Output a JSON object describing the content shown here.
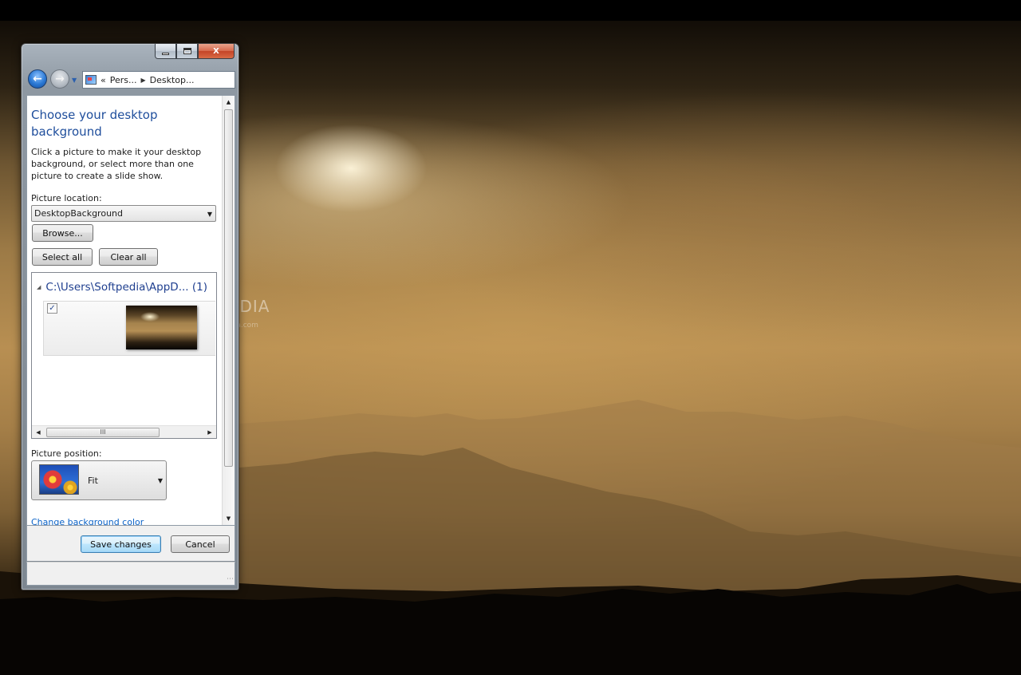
{
  "window": {
    "caption_buttons": {
      "minimize_icon": "minimize-icon",
      "maximize_icon": "maximize-icon",
      "close_label": "X"
    },
    "address_bar": {
      "prefix": "«",
      "crumb1": "Pers...",
      "crumb2": "Desktop..."
    }
  },
  "content": {
    "title": "Choose your desktop background",
    "description": "Click a picture to make it your desktop background, or select more than one picture to create a slide show.",
    "picture_location_label": "Picture location:",
    "picture_location_value": "DesktopBackground",
    "browse_label": "Browse...",
    "select_all_label": "Select all",
    "clear_all_label": "Clear all",
    "gallery": {
      "group_header": "C:\\Users\\Softpedia\\AppD... (1)",
      "items": [
        {
          "checked": true,
          "check_glyph": "✓"
        }
      ],
      "hscroll_grip": "III"
    },
    "picture_position_label": "Picture position:",
    "picture_position_value": "Fit",
    "change_background_color_label": "Change background color"
  },
  "footer": {
    "save_label": "Save changes",
    "cancel_label": "Cancel"
  },
  "desktop": {
    "watermark": "SOFTPEDIA",
    "watermark_url": "www.softpedia.com"
  }
}
